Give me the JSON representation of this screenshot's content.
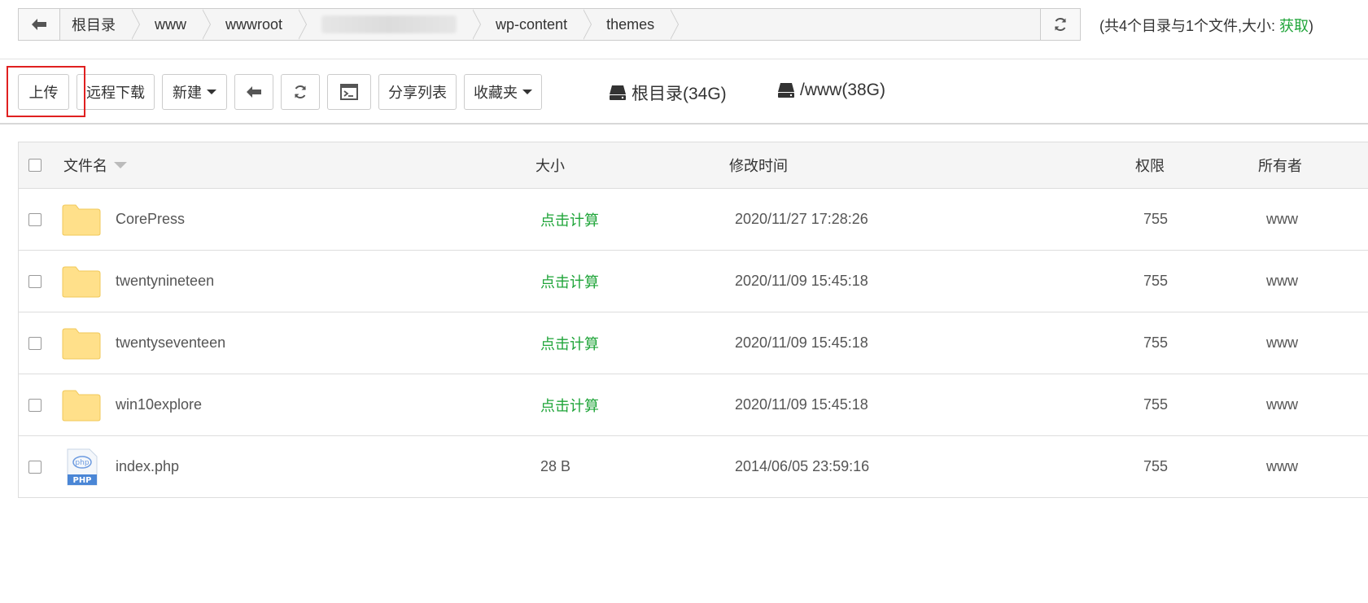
{
  "breadcrumbs": [
    "根目录",
    "www",
    "wwwroot",
    "",
    "wp-content",
    "themes"
  ],
  "summary": {
    "text": "(共4个目录与1个文件,大小: ",
    "link": "获取",
    "close": ")"
  },
  "toolbar": {
    "upload": "上传",
    "remote_download": "远程下载",
    "new": "新建",
    "share_list": "分享列表",
    "favorites": "收藏夹"
  },
  "disks": [
    {
      "label": "根目录(34G)"
    },
    {
      "label": "/www(38G)"
    }
  ],
  "columns": {
    "name": "文件名",
    "size": "大小",
    "mtime": "修改时间",
    "perm": "权限",
    "owner": "所有者"
  },
  "files": [
    {
      "name": "CorePress",
      "type": "folder",
      "size": "点击计算",
      "mtime": "2020/11/27 17:28:26",
      "perm": "755",
      "owner": "www"
    },
    {
      "name": "twentynineteen",
      "type": "folder",
      "size": "点击计算",
      "mtime": "2020/11/09 15:45:18",
      "perm": "755",
      "owner": "www"
    },
    {
      "name": "twentyseventeen",
      "type": "folder",
      "size": "点击计算",
      "mtime": "2020/11/09 15:45:18",
      "perm": "755",
      "owner": "www"
    },
    {
      "name": "win10explore",
      "type": "folder",
      "size": "点击计算",
      "mtime": "2020/11/09 15:45:18",
      "perm": "755",
      "owner": "www"
    },
    {
      "name": "index.php",
      "type": "php",
      "size": "28 B",
      "mtime": "2014/06/05 23:59:16",
      "perm": "755",
      "owner": "www"
    }
  ],
  "colors": {
    "accent": "#20a53a",
    "highlight": "#e02020",
    "folder": "#ffe08a"
  },
  "icons": {
    "php_label": "PHP",
    "php_text": "php"
  }
}
